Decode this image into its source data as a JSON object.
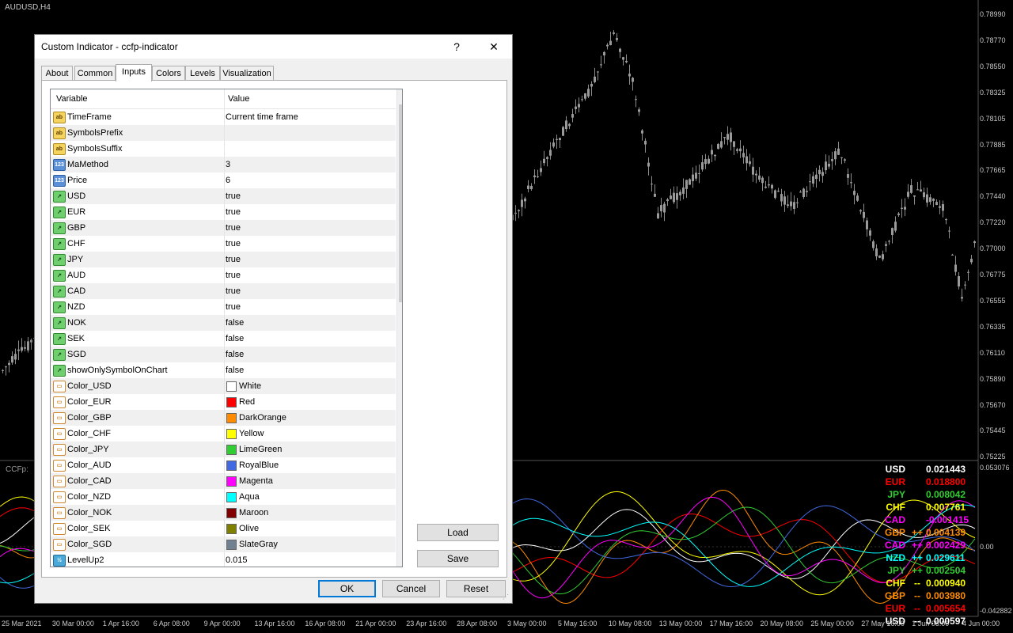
{
  "chart": {
    "symbol_title": "AUDUSD,H4",
    "subwindow_title": "CCFp:",
    "price_axis": [
      "0.78990",
      "0.78770",
      "0.78550",
      "0.78325",
      "0.78105",
      "0.77885",
      "0.77665",
      "0.77440",
      "0.77220",
      "0.77000",
      "0.76775",
      "0.76555",
      "0.76335",
      "0.76110",
      "0.75890",
      "0.75670",
      "0.75445",
      "0.75225"
    ],
    "sub_axis": [
      "0.053076",
      "0.00",
      "-0.042882"
    ],
    "time_axis": [
      "25 Mar 2021",
      "30 Mar 00:00",
      "1 Apr 16:00",
      "6 Apr 08:00",
      "9 Apr 00:00",
      "13 Apr 16:00",
      "16 Apr 08:00",
      "21 Apr 00:00",
      "23 Apr 16:00",
      "28 Apr 08:00",
      "3 May 00:00",
      "5 May 16:00",
      "10 May 08:00",
      "13 May 00:00",
      "17 May 16:00",
      "20 May 08:00",
      "25 May 00:00",
      "27 May 16:00",
      "1 Jun 08:00",
      "4 Jun 00:00"
    ],
    "currency_table": [
      {
        "name": "USD",
        "arrow": "",
        "value": "0.021443",
        "color": "#ffffff"
      },
      {
        "name": "EUR",
        "arrow": "",
        "value": "0.018800",
        "color": "#ff0000"
      },
      {
        "name": "JPY",
        "arrow": "",
        "value": "0.008042",
        "color": "#32cd32"
      },
      {
        "name": "CHF",
        "arrow": "",
        "value": "0.007761",
        "color": "#ffff00"
      },
      {
        "name": "CAD",
        "arrow": "",
        "value": "-0.001415",
        "color": "#ff00ff"
      },
      {
        "name": "GBP",
        "arrow": "++",
        "value": "0.004139",
        "color": "#ff8c00"
      },
      {
        "name": "CAD",
        "arrow": "++",
        "value": "0.002429",
        "color": "#ff00ff"
      },
      {
        "name": "NZD",
        "arrow": "++",
        "value": "0.029611",
        "color": "#00ffff"
      },
      {
        "name": "JPY",
        "arrow": "++",
        "value": "0.002504",
        "color": "#32cd32"
      },
      {
        "name": "CHF",
        "arrow": "--",
        "value": "0.000940",
        "color": "#ffff00"
      },
      {
        "name": "GBP",
        "arrow": "--",
        "value": "0.003980",
        "color": "#ff8c00"
      },
      {
        "name": "EUR",
        "arrow": "--",
        "value": "0.005654",
        "color": "#ff0000"
      },
      {
        "name": "USD",
        "arrow": "--",
        "value": "0.000597",
        "color": "#ffffff"
      }
    ]
  },
  "dialog": {
    "title": "Custom Indicator - ccfp-indicator",
    "help_symbol": "?",
    "close_symbol": "✕",
    "tabs": [
      "About",
      "Common",
      "Inputs",
      "Colors",
      "Levels",
      "Visualization"
    ],
    "active_tab": "Inputs",
    "grid": {
      "header_variable": "Variable",
      "header_value": "Value",
      "rows": [
        {
          "icon": "ab",
          "variable": "TimeFrame",
          "value": "Current time frame"
        },
        {
          "icon": "ab",
          "variable": "SymbolsPrefix",
          "value": ""
        },
        {
          "icon": "ab",
          "variable": "SymbolsSuffix",
          "value": ""
        },
        {
          "icon": "123",
          "variable": "MaMethod",
          "value": "3"
        },
        {
          "icon": "123",
          "variable": "Price",
          "value": "6"
        },
        {
          "icon": "bool",
          "variable": "USD",
          "value": "true"
        },
        {
          "icon": "bool",
          "variable": "EUR",
          "value": "true"
        },
        {
          "icon": "bool",
          "variable": "GBP",
          "value": "true"
        },
        {
          "icon": "bool",
          "variable": "CHF",
          "value": "true"
        },
        {
          "icon": "bool",
          "variable": "JPY",
          "value": "true"
        },
        {
          "icon": "bool",
          "variable": "AUD",
          "value": "true"
        },
        {
          "icon": "bool",
          "variable": "CAD",
          "value": "true"
        },
        {
          "icon": "bool",
          "variable": "NZD",
          "value": "true"
        },
        {
          "icon": "bool",
          "variable": "NOK",
          "value": "false"
        },
        {
          "icon": "bool",
          "variable": "SEK",
          "value": "false"
        },
        {
          "icon": "bool",
          "variable": "SGD",
          "value": "false"
        },
        {
          "icon": "bool",
          "variable": "showOnlySymbolOnChart",
          "value": "false"
        },
        {
          "icon": "color",
          "variable": "Color_USD",
          "value": "White",
          "swatch": "#ffffff"
        },
        {
          "icon": "color",
          "variable": "Color_EUR",
          "value": "Red",
          "swatch": "#ff0000"
        },
        {
          "icon": "color",
          "variable": "Color_GBP",
          "value": "DarkOrange",
          "swatch": "#ff8c00"
        },
        {
          "icon": "color",
          "variable": "Color_CHF",
          "value": "Yellow",
          "swatch": "#ffff00"
        },
        {
          "icon": "color",
          "variable": "Color_JPY",
          "value": "LimeGreen",
          "swatch": "#32cd32"
        },
        {
          "icon": "color",
          "variable": "Color_AUD",
          "value": "RoyalBlue",
          "swatch": "#4169e1"
        },
        {
          "icon": "color",
          "variable": "Color_CAD",
          "value": "Magenta",
          "swatch": "#ff00ff"
        },
        {
          "icon": "color",
          "variable": "Color_NZD",
          "value": "Aqua",
          "swatch": "#00ffff"
        },
        {
          "icon": "color",
          "variable": "Color_NOK",
          "value": "Maroon",
          "swatch": "#800000"
        },
        {
          "icon": "color",
          "variable": "Color_SEK",
          "value": "Olive",
          "swatch": "#808000"
        },
        {
          "icon": "color",
          "variable": "Color_SGD",
          "value": "SlateGray",
          "swatch": "#708090"
        },
        {
          "icon": "dbl",
          "variable": "LevelUp2",
          "value": "0.015"
        }
      ]
    },
    "buttons": {
      "load": "Load",
      "save": "Save",
      "ok": "OK",
      "cancel": "Cancel",
      "reset": "Reset"
    }
  }
}
